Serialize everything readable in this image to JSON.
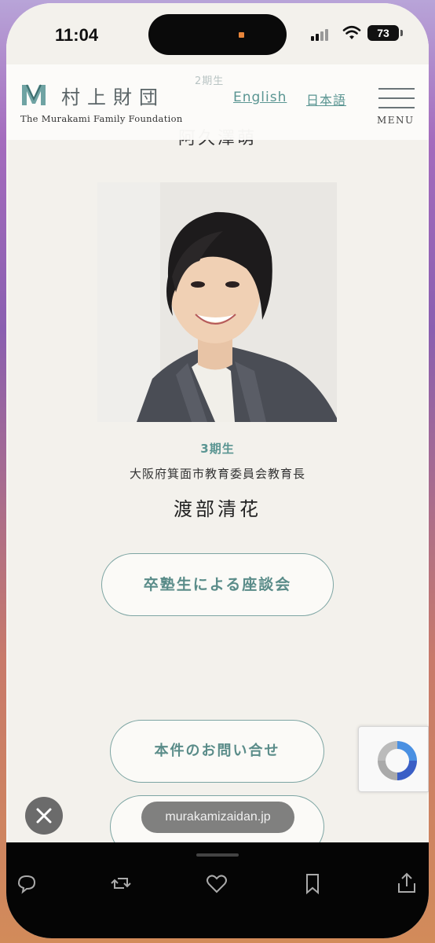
{
  "status_bar": {
    "time": "11:04",
    "battery": "73"
  },
  "header": {
    "faded_text": "2期生",
    "logo_jp": "村上財団",
    "logo_en": "The Murakami Family Foundation",
    "lang_english": "English",
    "lang_japanese": "日本語",
    "menu_label": "MENU"
  },
  "content": {
    "previous_name": "阿久澤萌",
    "cohort": "3期生",
    "role": "大阪府箕面市教育委員会教育長",
    "name": "渡部清花",
    "discussion_button": "卒塾生による座談会",
    "contact_button": "本件のお問い合せ"
  },
  "browser": {
    "url": "murakamizaidan.jp"
  },
  "colors": {
    "accent": "#5a9592",
    "page_bg": "#f3f1ec"
  }
}
